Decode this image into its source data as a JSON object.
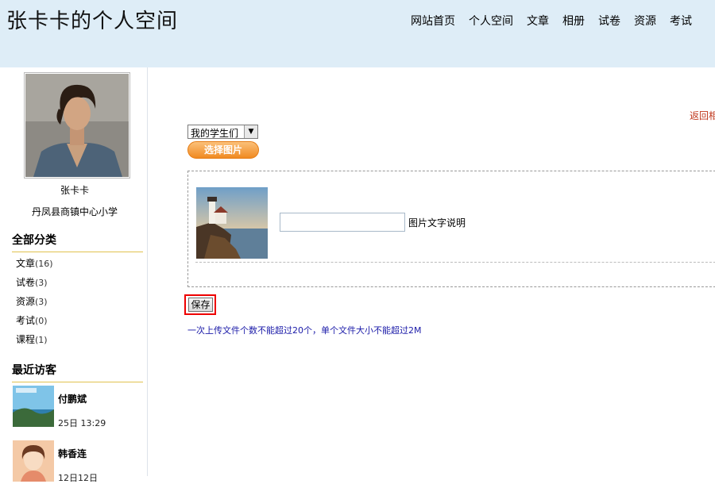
{
  "header": {
    "site_title": "张卡卡的个人空间",
    "nav": [
      "网站首页",
      "个人空间",
      "文章",
      "相册",
      "试卷",
      "资源",
      "考试"
    ]
  },
  "profile": {
    "name": "张卡卡",
    "school": "丹凤县商镇中心小学"
  },
  "categories": {
    "title": "全部分类",
    "items": [
      {
        "label": "文章",
        "count": "(16)"
      },
      {
        "label": "试卷",
        "count": "(3)"
      },
      {
        "label": "资源",
        "count": "(3)"
      },
      {
        "label": "考试",
        "count": "(0)"
      },
      {
        "label": "课程",
        "count": "(1)"
      }
    ]
  },
  "visitors": {
    "title": "最近访客",
    "items": [
      {
        "name": "付鹏斌",
        "time": "25日  13:29"
      },
      {
        "name": "韩香连",
        "time": "12日12日"
      }
    ]
  },
  "main": {
    "back_link": "返回相",
    "album_select": "我的学生们",
    "pick_button": "选择图片",
    "caption_value": "",
    "caption_label": "图片文字说明",
    "save_button": "保存",
    "notice": "一次上传文件个数不能超过20个，单个文件大小不能超过2M"
  },
  "icons": {
    "select_arrow": "chevron-down-icon"
  }
}
